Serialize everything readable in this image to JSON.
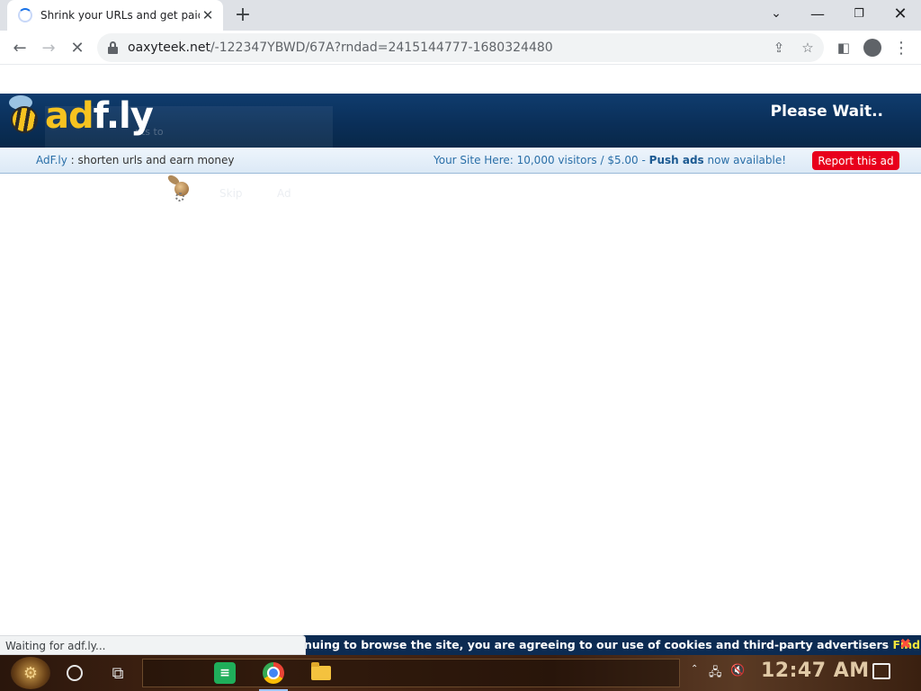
{
  "browser": {
    "tab_title": "Shrink your URLs and get paid!",
    "url_host": "oaxyteek.net",
    "url_path": "/-122347YBWD/67A?rndad=2415144777-1680324480"
  },
  "page": {
    "header_ghost_text": "nts to",
    "please_wait": "Please Wait..",
    "infobar_brand": "AdF.ly",
    "infobar_tagline": " : shorten urls and earn money",
    "promo_prefix": "Your Site Here: 10,000 visitors / $5.00 - ",
    "promo_bold": "Push ads",
    "promo_suffix": " now available!",
    "report_button": "Report this ad",
    "ghost_link_1": "Skip",
    "ghost_link_2": "Ad"
  },
  "status_text": "Waiting for adf.ly...",
  "cookie_bar": {
    "text": "nuing to browse the site, you are agreeing to our use of cookies and third-party advertisers ",
    "link": "Find out more."
  },
  "taskbar": {
    "clock": "12:47 AM"
  },
  "colors": {
    "header_blue": "#0a2e57",
    "report_red": "#e8001c",
    "cookie_link": "#f2e43c"
  },
  "icons": [
    "loading-spinner-icon",
    "close-icon",
    "plus-icon",
    "chevron-down-icon",
    "minimize-icon",
    "restore-icon",
    "back-arrow-icon",
    "forward-arrow-icon",
    "stop-icon",
    "lock-icon",
    "share-icon",
    "star-icon",
    "side-panel-icon",
    "profile-icon",
    "menu-icon",
    "bee-icon",
    "cortana-icon",
    "task-view-icon",
    "network-icon",
    "volume-muted-icon",
    "notification-icon"
  ]
}
